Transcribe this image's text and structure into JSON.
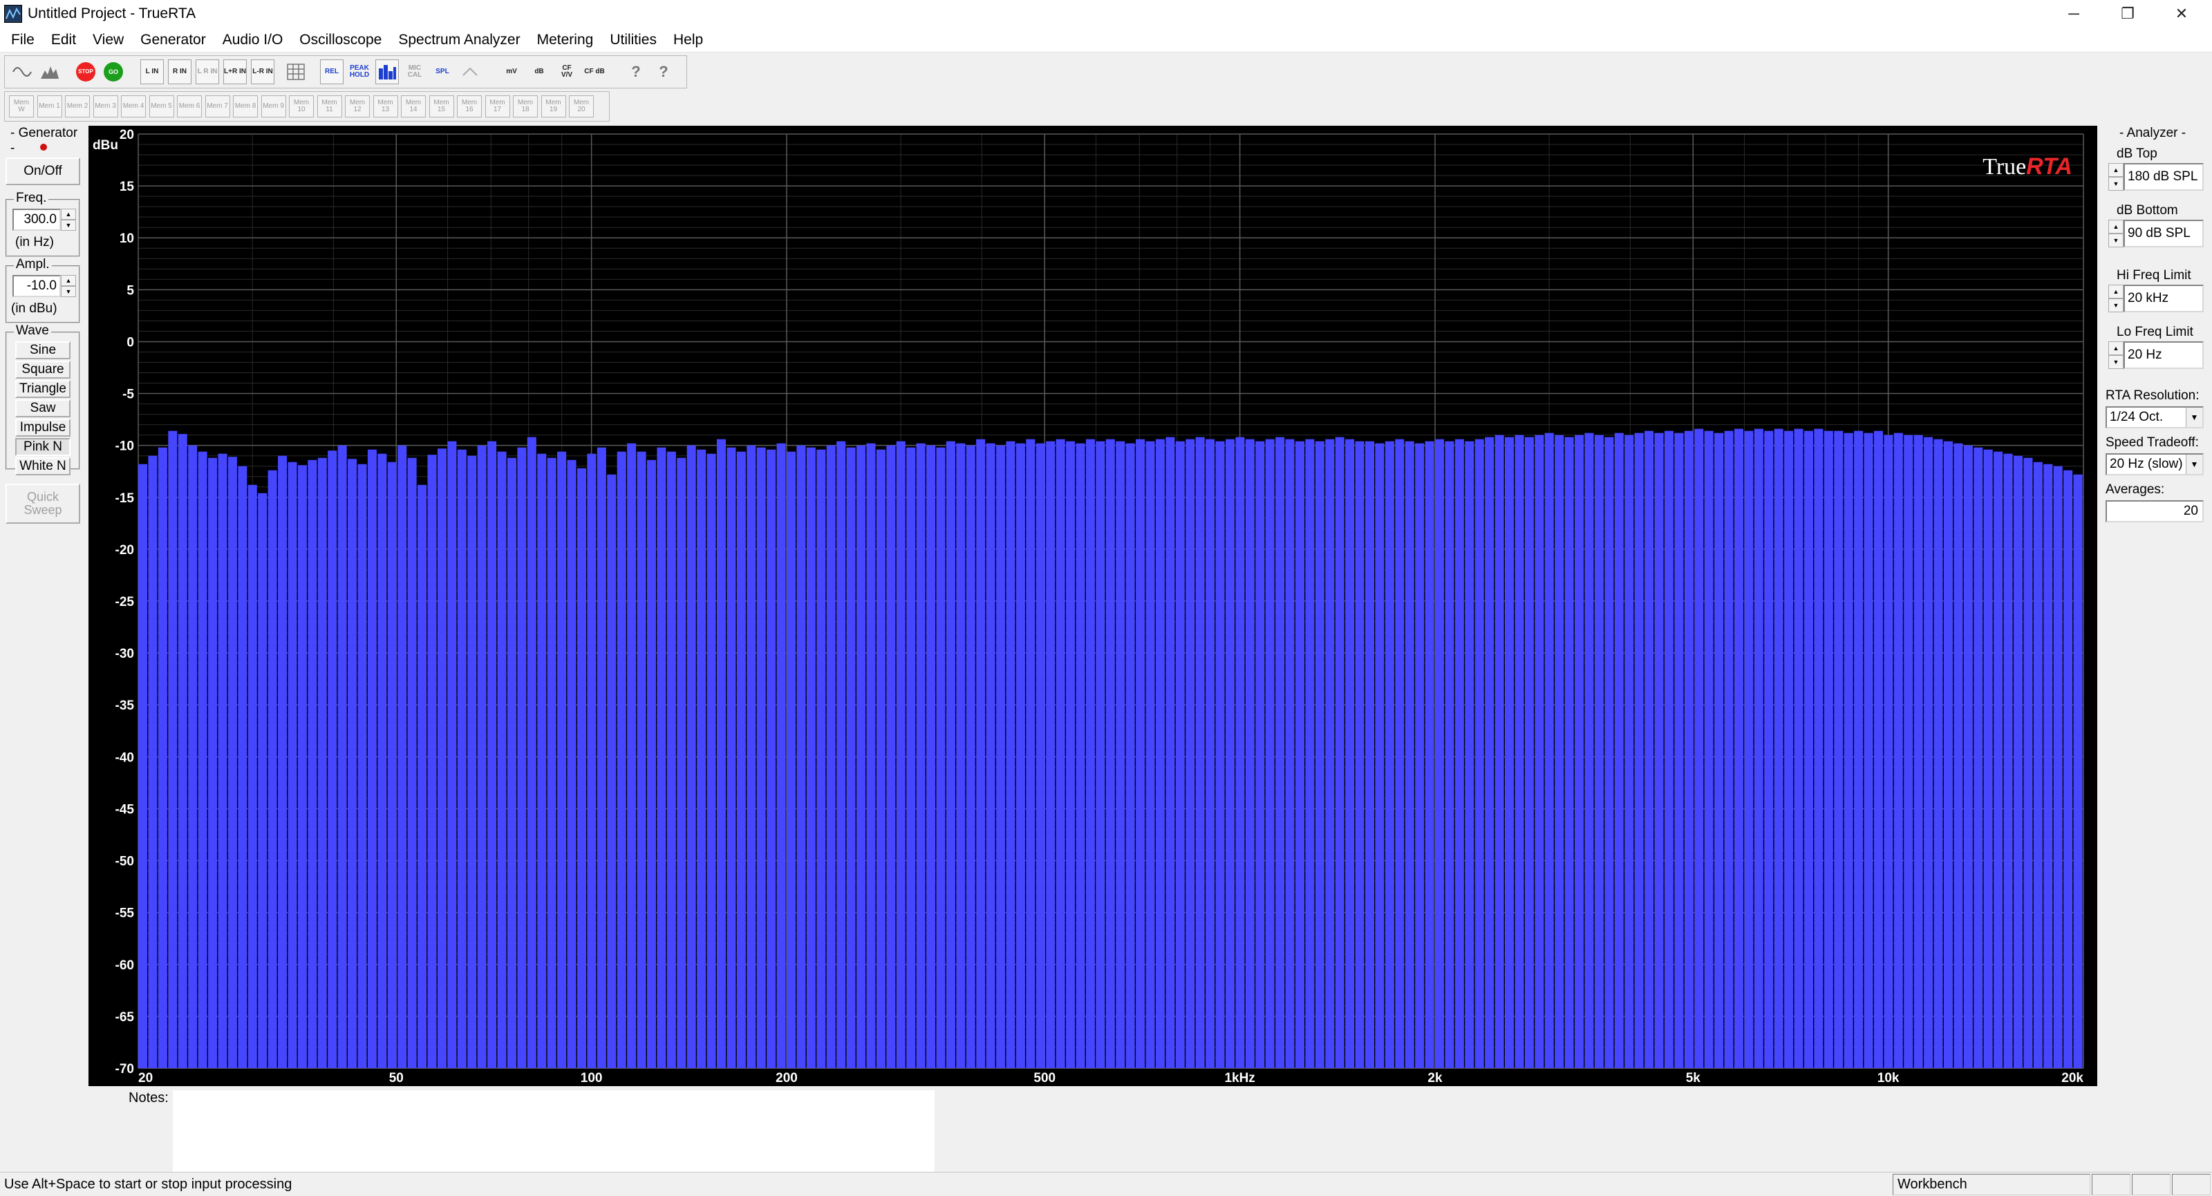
{
  "window": {
    "title": "Untitled Project - TrueRTA",
    "minimize_glyph": "─",
    "restore_glyph": "❐",
    "close_glyph": "✕"
  },
  "menu": [
    "File",
    "Edit",
    "View",
    "Generator",
    "Audio I/O",
    "Oscilloscope",
    "Spectrum Analyzer",
    "Metering",
    "Utilities",
    "Help"
  ],
  "toolbar": {
    "buttons": [
      {
        "name": "oscilloscope-mode-button",
        "label": "",
        "icon": "sine-wave-icon"
      },
      {
        "name": "spectrum-mode-button",
        "label": "",
        "icon": "spectrum-icon"
      },
      {
        "name": "stop-button",
        "label": "STOP",
        "icon": "stop-icon"
      },
      {
        "name": "go-button",
        "label": "GO",
        "icon": "go-icon"
      },
      {
        "name": "left-input-button",
        "label": "L IN",
        "icon": ""
      },
      {
        "name": "right-input-button",
        "label": "R IN",
        "icon": ""
      },
      {
        "name": "left-right-input-button",
        "label": "L R IN",
        "icon": ""
      },
      {
        "name": "left-plus-right-input-button",
        "label": "L+R IN",
        "icon": ""
      },
      {
        "name": "left-minus-right-input-button",
        "label": "L-R IN",
        "icon": ""
      },
      {
        "name": "grid-button",
        "label": "",
        "icon": "grid-icon"
      },
      {
        "name": "relative-button",
        "label": "REL",
        "icon": ""
      },
      {
        "name": "peak-hold-button",
        "label": "PEAK HOLD",
        "icon": ""
      },
      {
        "name": "bar-display-button",
        "label": "",
        "icon": "bars-icon"
      },
      {
        "name": "mic-cal-button",
        "label": "MIC CAL",
        "icon": ""
      },
      {
        "name": "spl-button",
        "label": "SPL",
        "icon": ""
      },
      {
        "name": "scale-button",
        "label": "",
        "icon": "scale-icon"
      },
      {
        "name": "millivolt-button",
        "label": "mV",
        "icon": ""
      },
      {
        "name": "db-button",
        "label": "dB",
        "icon": ""
      },
      {
        "name": "cf-vv-button",
        "label": "CF V/V",
        "icon": ""
      },
      {
        "name": "cf-db-button",
        "label": "CF dB",
        "icon": ""
      },
      {
        "name": "help-button",
        "label": "?",
        "icon": "help-icon"
      },
      {
        "name": "context-help-button",
        "label": "?",
        "icon": "context-help-icon"
      }
    ],
    "memories": [
      "Mem W",
      "Mem 1",
      "Mem 2",
      "Mem 3",
      "Mem 4",
      "Mem 5",
      "Mem 6",
      "Mem 7",
      "Mem 8",
      "Mem 9",
      "Mem 10",
      "Mem 11",
      "Mem 12",
      "Mem 13",
      "Mem 14",
      "Mem 15",
      "Mem 16",
      "Mem 17",
      "Mem 18",
      "Mem 19",
      "Mem 20"
    ]
  },
  "generator": {
    "title": "- Generator -",
    "on_off": "On/Off",
    "freq_label": "Freq.",
    "freq_value": "300.0",
    "freq_unit": "(in Hz)",
    "ampl_label": "Ampl.",
    "ampl_value": "-10.0",
    "ampl_unit": "(in dBu)",
    "wave_label": "Wave",
    "waves": [
      "Sine",
      "Square",
      "Triangle",
      "Saw",
      "Impulse",
      "Pink N",
      "White N"
    ],
    "selected_wave": "Pink N",
    "quick_sweep": "Quick Sweep"
  },
  "analyzer": {
    "title": "- Analyzer -",
    "db_top_label": "dB Top",
    "db_top_value": "180 dB SPL",
    "db_bottom_label": "dB Bottom",
    "db_bottom_value": "90 dB SPL",
    "hi_freq_label": "Hi Freq Limit",
    "hi_freq_value": "20 kHz",
    "lo_freq_label": "Lo Freq Limit",
    "lo_freq_value": "20 Hz",
    "resolution_label": "RTA Resolution:",
    "resolution_value": "1/24 Oct.",
    "speed_label": "Speed Tradeoff:",
    "speed_value": "20 Hz (slow)",
    "averages_label": "Averages:",
    "averages_value": "20"
  },
  "notes_label": "Notes:",
  "status": {
    "hint": "Use Alt+Space to start or stop input processing",
    "mode": "Workbench"
  },
  "colors": {
    "bars": "#4646ff",
    "graph_bg": "#000000",
    "grid_major": "#5a5a5a",
    "grid_minor": "#2a2a2a",
    "logo_true": "#ffffff",
    "logo_rta": "#e8262a"
  },
  "chart_data": {
    "type": "bar",
    "logo": {
      "part1": "True",
      "part2": "RTA"
    },
    "ylabel": "dBu",
    "ylim": [
      -70,
      20
    ],
    "yticks": [
      20,
      15,
      10,
      5,
      0,
      -5,
      -10,
      -15,
      -20,
      -25,
      -30,
      -35,
      -40,
      -45,
      -50,
      -55,
      -60,
      -65,
      -70
    ],
    "x_scale": "log",
    "xlim": [
      20,
      20000
    ],
    "xticks": [
      {
        "value": 20,
        "label": "20"
      },
      {
        "value": 50,
        "label": "50"
      },
      {
        "value": 100,
        "label": "100"
      },
      {
        "value": 200,
        "label": "200"
      },
      {
        "value": 500,
        "label": "500"
      },
      {
        "value": 1000,
        "label": "1kHz"
      },
      {
        "value": 2000,
        "label": "2k"
      },
      {
        "value": 5000,
        "label": "5k"
      },
      {
        "value": 10000,
        "label": "10k"
      },
      {
        "value": 20000,
        "label": "20k"
      }
    ],
    "resolution": "1/24 Oct.",
    "values": [
      -11.8,
      -11.0,
      -10.2,
      -8.6,
      -8.9,
      -10.0,
      -10.6,
      -11.2,
      -10.8,
      -11.1,
      -12.0,
      -13.8,
      -14.6,
      -12.4,
      -11.0,
      -11.6,
      -11.9,
      -11.4,
      -11.2,
      -10.5,
      -10.0,
      -11.3,
      -11.8,
      -10.4,
      -10.8,
      -11.6,
      -10.0,
      -11.2,
      -13.8,
      -10.9,
      -10.3,
      -9.6,
      -10.4,
      -11.0,
      -10.0,
      -9.6,
      -10.6,
      -11.2,
      -10.2,
      -9.2,
      -10.8,
      -11.2,
      -10.6,
      -11.4,
      -12.2,
      -10.8,
      -10.2,
      -12.8,
      -10.6,
      -9.8,
      -10.6,
      -11.4,
      -10.2,
      -10.6,
      -11.2,
      -10.0,
      -10.4,
      -10.8,
      -9.4,
      -10.2,
      -10.6,
      -10.0,
      -10.2,
      -10.4,
      -9.8,
      -10.6,
      -10.0,
      -10.2,
      -10.4,
      -10.0,
      -9.6,
      -10.2,
      -10.0,
      -9.8,
      -10.4,
      -10.0,
      -9.6,
      -10.2,
      -9.8,
      -10.0,
      -10.2,
      -9.6,
      -9.8,
      -10.0,
      -9.4,
      -9.8,
      -10.0,
      -9.6,
      -9.8,
      -9.4,
      -9.8,
      -9.6,
      -9.4,
      -9.6,
      -9.8,
      -9.4,
      -9.6,
      -9.4,
      -9.6,
      -9.8,
      -9.4,
      -9.6,
      -9.4,
      -9.2,
      -9.6,
      -9.4,
      -9.2,
      -9.4,
      -9.6,
      -9.4,
      -9.2,
      -9.4,
      -9.6,
      -9.4,
      -9.2,
      -9.4,
      -9.6,
      -9.4,
      -9.6,
      -9.4,
      -9.2,
      -9.4,
      -9.6,
      -9.6,
      -9.8,
      -9.6,
      -9.4,
      -9.6,
      -9.8,
      -9.6,
      -9.4,
      -9.6,
      -9.4,
      -9.6,
      -9.4,
      -9.2,
      -9.0,
      -9.2,
      -9.0,
      -9.2,
      -9.0,
      -8.8,
      -9.0,
      -9.2,
      -9.0,
      -8.8,
      -9.0,
      -9.2,
      -8.8,
      -9.0,
      -8.8,
      -8.6,
      -8.8,
      -8.6,
      -8.8,
      -8.6,
      -8.4,
      -8.6,
      -8.8,
      -8.6,
      -8.4,
      -8.6,
      -8.4,
      -8.6,
      -8.4,
      -8.6,
      -8.4,
      -8.6,
      -8.4,
      -8.6,
      -8.6,
      -8.8,
      -8.6,
      -8.8,
      -8.6,
      -9.0,
      -8.8,
      -9.0,
      -9.0,
      -9.2,
      -9.4,
      -9.6,
      -9.8,
      -10.0,
      -10.2,
      -10.4,
      -10.6,
      -10.8,
      -11.0,
      -11.2,
      -11.6,
      -11.8,
      -12.0,
      -12.4,
      -12.8
    ]
  }
}
